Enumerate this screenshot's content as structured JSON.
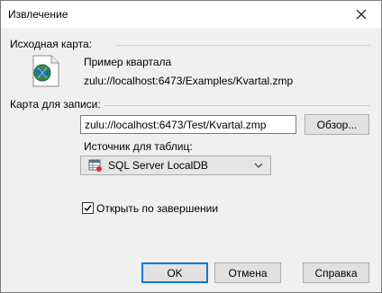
{
  "window": {
    "title": "Извлечение"
  },
  "source": {
    "label": "Исходная карта:",
    "name": "Пример квартала",
    "path": "zulu://localhost:6473/Examples/Kvartal.zmp"
  },
  "target": {
    "label": "Карта для записи:",
    "path_value": "zulu://localhost:6473/Test/Kvartal.zmp",
    "browse_label": "Обзор..."
  },
  "table_source": {
    "label": "Источник для таблиц:",
    "selected": "SQL Server LocalDB"
  },
  "open_on_finish": {
    "label": "Открыть по завершении",
    "checked": true
  },
  "buttons": {
    "ok": "OK",
    "cancel": "Отмена",
    "help": "Справка"
  },
  "colors": {
    "accent": "#0078d7",
    "icon_green": "#2e8b57",
    "icon_blue": "#1e66c8"
  }
}
